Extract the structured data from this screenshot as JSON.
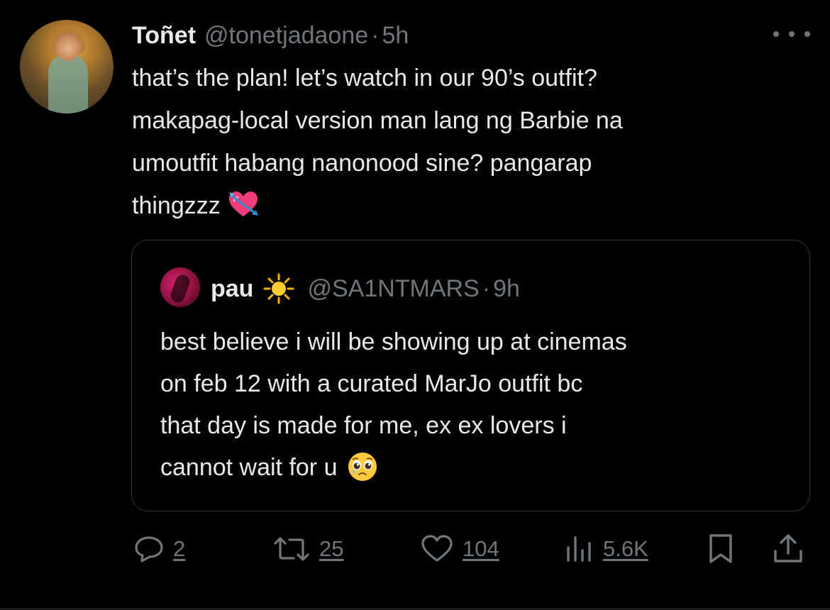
{
  "tweet": {
    "author_name": "Toñet",
    "author_handle": "@tonetjadaone",
    "separator": "·",
    "time": "5h",
    "text_lines": [
      "that’s the plan! let’s watch in our 90’s outfit?",
      "makapag-local version man lang ng Barbie na",
      "umoutfit habang nanonood sine? pangarap",
      "thingzzz"
    ],
    "text_emoji": "heart-with-arrow-icon"
  },
  "quoted_tweet": {
    "author_name": "pau",
    "name_emoji": "sun-icon",
    "author_handle": "@SA1NTMARS",
    "separator": "·",
    "time": "9h",
    "text_lines": [
      "best believe i will be showing up at cinemas",
      "on feb 12 with a curated MarJo outfit bc",
      "that day is made for me, ex ex lovers i",
      "cannot wait for u"
    ],
    "text_emoji": "pleading-face-icon"
  },
  "actions": {
    "replies": "2",
    "retweets": "25",
    "likes": "104",
    "views": "5.6K"
  },
  "colors": {
    "background": "#000000",
    "text": "#e7e9ea",
    "secondary": "#71767b",
    "border": "#2f3336"
  }
}
